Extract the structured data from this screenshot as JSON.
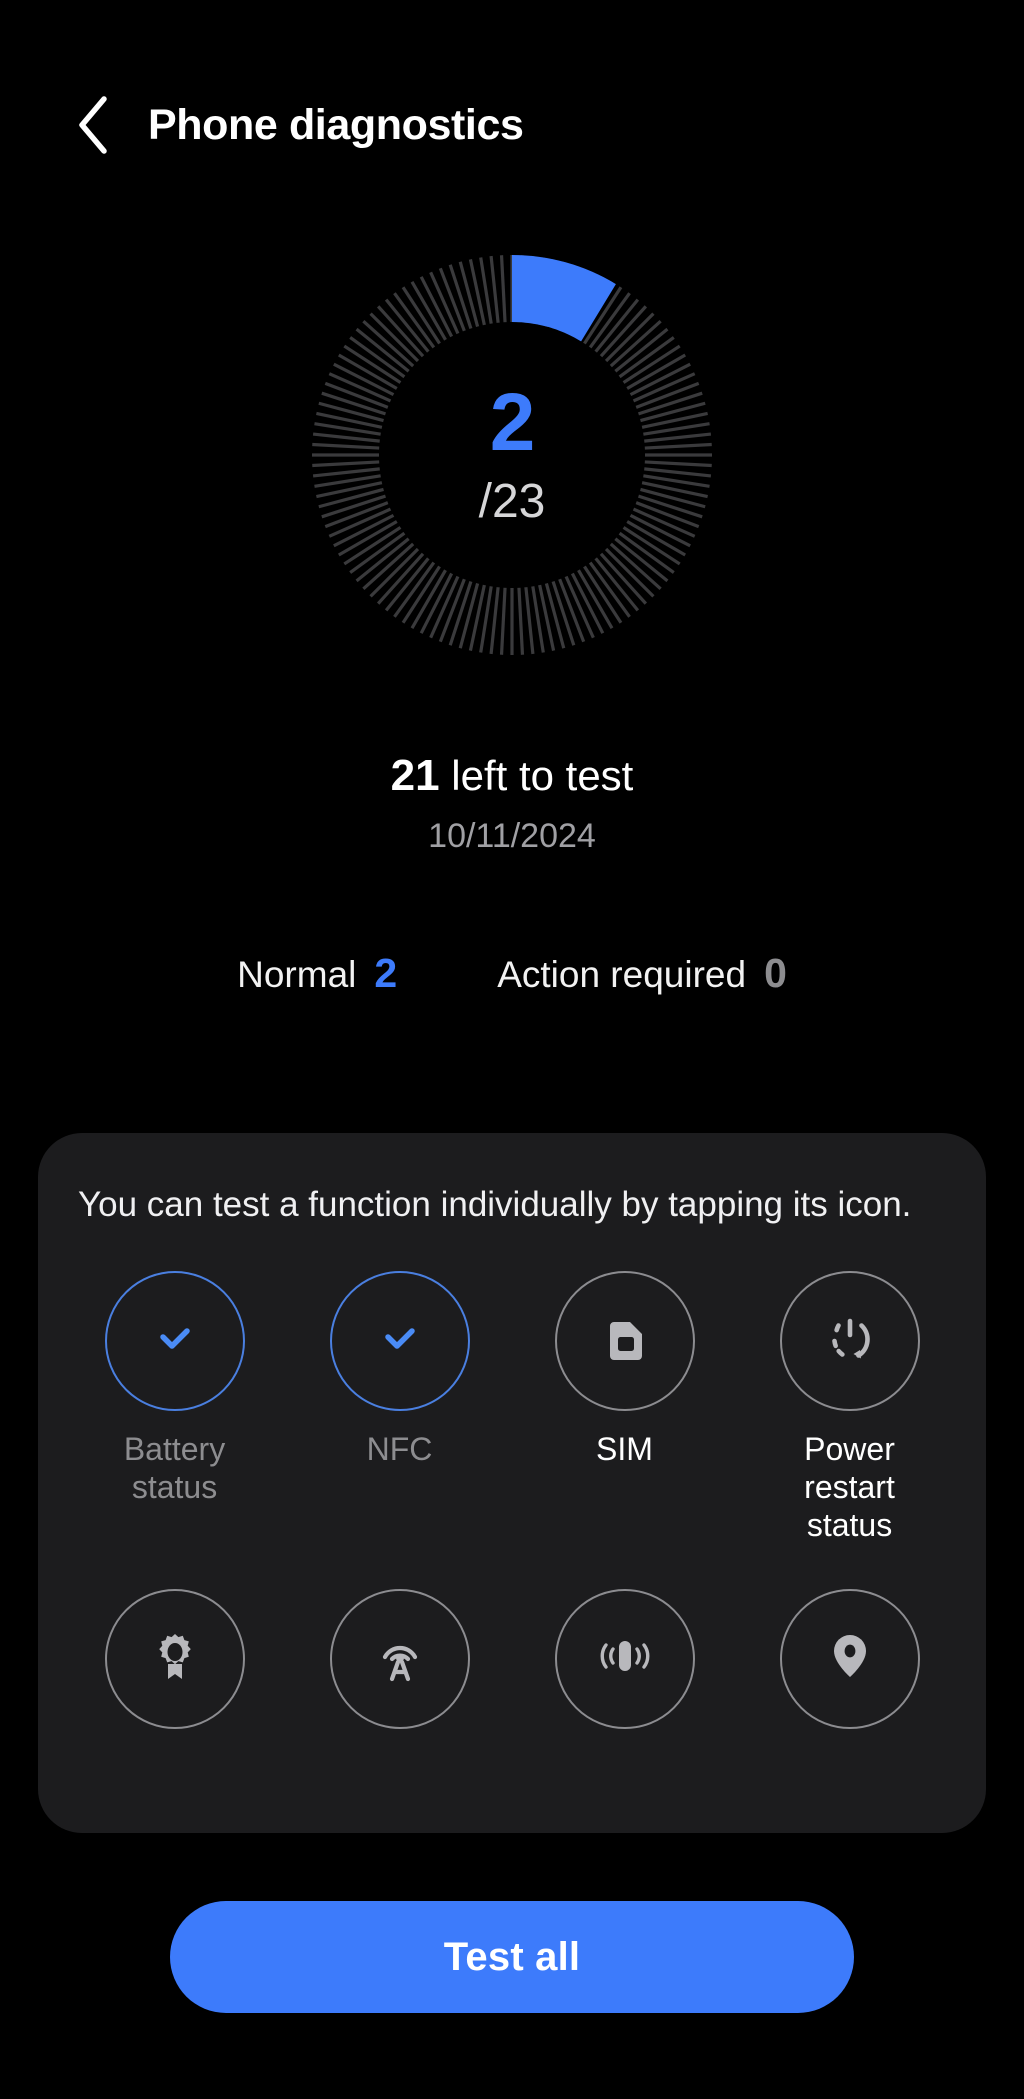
{
  "header": {
    "back_icon": "chevron-left-icon",
    "title": "Phone diagnostics"
  },
  "progress": {
    "done": "2",
    "total_label": "/23",
    "total": 23,
    "ticks": 120,
    "accent_color": "#3d7bfb",
    "track_color": "#3a3a3c"
  },
  "summary": {
    "left_count": "21",
    "left_label": " left to test",
    "date": "10/11/2024"
  },
  "stats": [
    {
      "label": "Normal",
      "value": "2",
      "tone": "normal"
    },
    {
      "label": "Action required",
      "value": "0",
      "tone": "action"
    }
  ],
  "card": {
    "hint": "You can test a function individually by tapping its icon.",
    "row1": [
      {
        "label": "Battery status",
        "icon": "check-icon",
        "state": "done"
      },
      {
        "label": "NFC",
        "icon": "check-icon",
        "state": "done"
      },
      {
        "label": "SIM",
        "icon": "sim-card-icon",
        "state": "untested"
      },
      {
        "label": "Power restart status",
        "icon": "power-restart-icon",
        "state": "untested"
      }
    ],
    "row2": [
      {
        "label": "",
        "icon": "award-ribbon-icon",
        "state": "untested"
      },
      {
        "label": "",
        "icon": "signal-tower-icon",
        "state": "untested"
      },
      {
        "label": "",
        "icon": "vibration-icon",
        "state": "untested"
      },
      {
        "label": "",
        "icon": "location-pin-icon",
        "state": "untested"
      }
    ]
  },
  "footer": {
    "test_all_label": "Test all"
  },
  "colors": {
    "background": "#000000",
    "card": "#1c1c1e",
    "accent": "#3d7bfb",
    "muted_text": "#8d8d90"
  }
}
